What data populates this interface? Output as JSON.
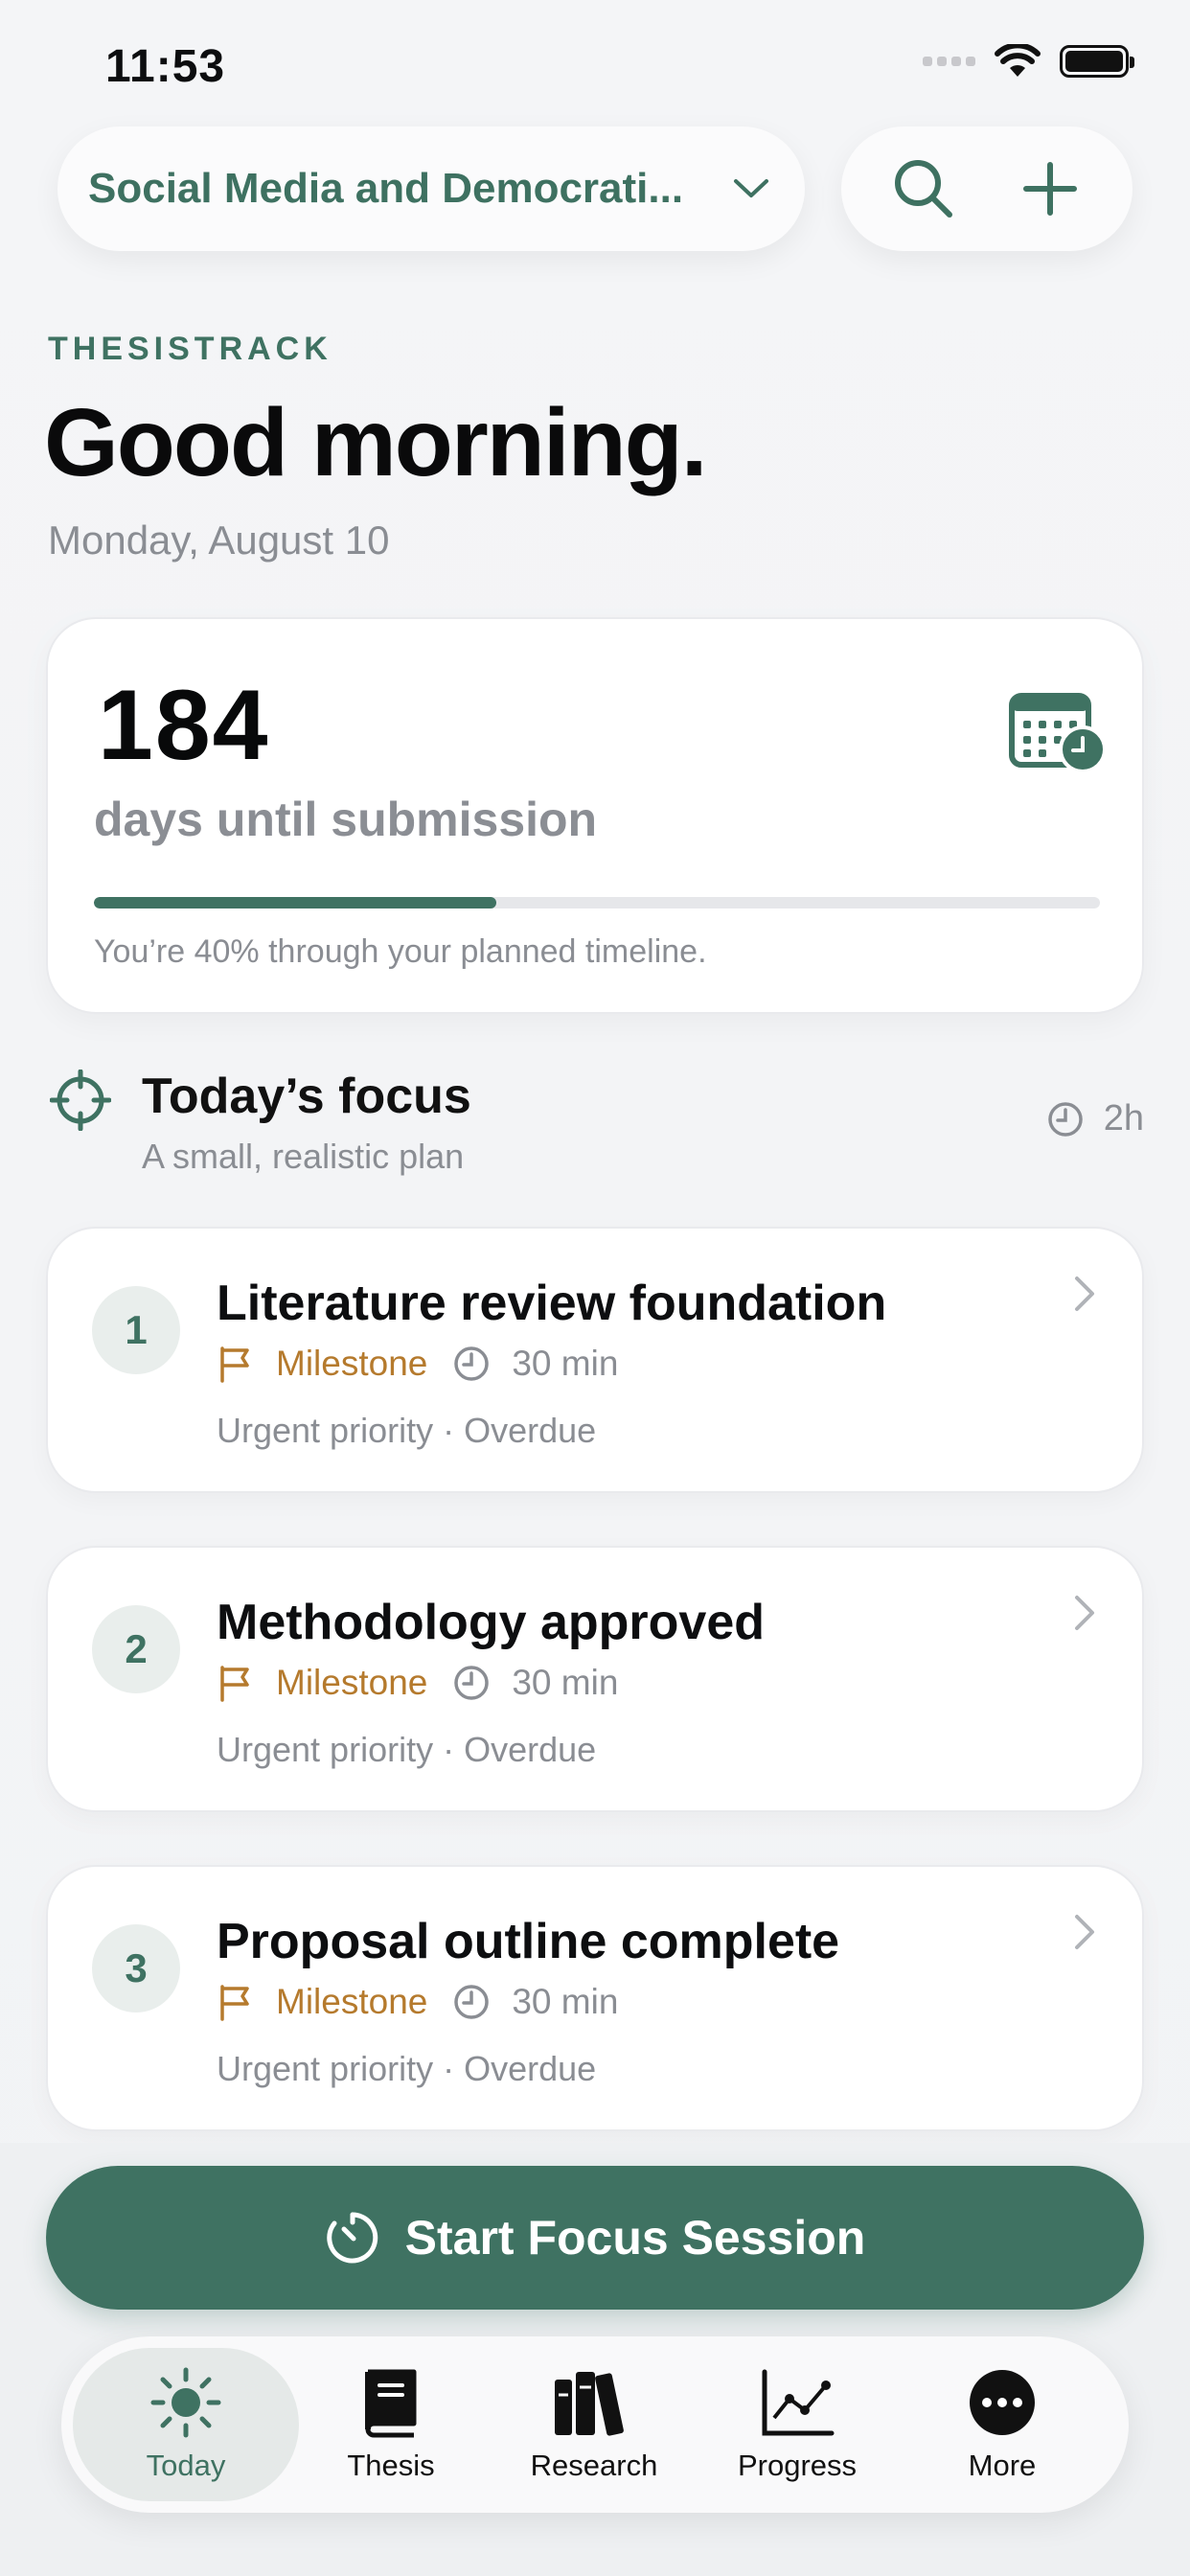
{
  "status_bar": {
    "time": "11:53"
  },
  "header": {
    "project_title": "Social Media and Democrati...",
    "search_icon": "search-icon",
    "add_icon": "plus-icon"
  },
  "greeting": {
    "brand": "THESISTRACK",
    "title": "Good morning.",
    "date": "Monday, August 10"
  },
  "countdown": {
    "days": "184",
    "label": "days until submission",
    "progress_fraction": 0.4,
    "caption": "You’re 40% through your planned timeline."
  },
  "focus": {
    "title": "Today’s focus",
    "subtitle": "A small, realistic plan",
    "total_time": "2h"
  },
  "tasks": [
    {
      "number": "1",
      "title": "Literature review foundation",
      "type": "Milestone",
      "duration": "30 min",
      "detail": "Urgent priority · Overdue"
    },
    {
      "number": "2",
      "title": "Methodology approved",
      "type": "Milestone",
      "duration": "30 min",
      "detail": "Urgent priority · Overdue"
    },
    {
      "number": "3",
      "title": "Proposal outline complete",
      "type": "Milestone",
      "duration": "30 min",
      "detail": "Urgent priority · Overdue"
    }
  ],
  "focus_button": {
    "label": "Start Focus Session"
  },
  "tabs": [
    {
      "label": "Today",
      "icon": "sun-icon",
      "active": true
    },
    {
      "label": "Thesis",
      "icon": "book-icon",
      "active": false
    },
    {
      "label": "Research",
      "icon": "books-icon",
      "active": false
    },
    {
      "label": "Progress",
      "icon": "chart-icon",
      "active": false
    },
    {
      "label": "More",
      "icon": "more-icon",
      "active": false
    }
  ],
  "colors": {
    "accent": "#3f7262",
    "milestone": "#b57a2d",
    "muted_text": "#8a8d93"
  }
}
